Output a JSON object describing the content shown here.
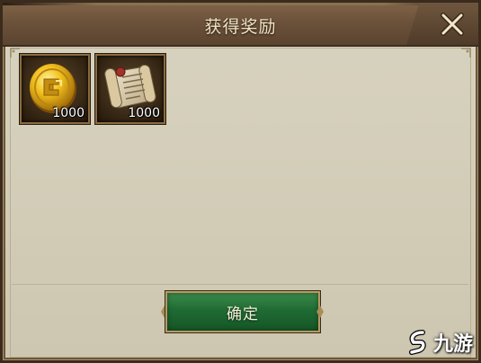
{
  "dialog": {
    "title": "获得奖励"
  },
  "rewards": [
    {
      "icon": "gold-coin-icon",
      "quantity": "1000"
    },
    {
      "icon": "scroll-icon",
      "quantity": "1000"
    }
  ],
  "confirm_button": {
    "label": "确定"
  },
  "watermark": {
    "text": "九游"
  },
  "colors": {
    "title_bar": "#6c523a",
    "panel": "#d2ccb7",
    "button_green": "#1f6b34",
    "border_gold": "#b79a63"
  }
}
